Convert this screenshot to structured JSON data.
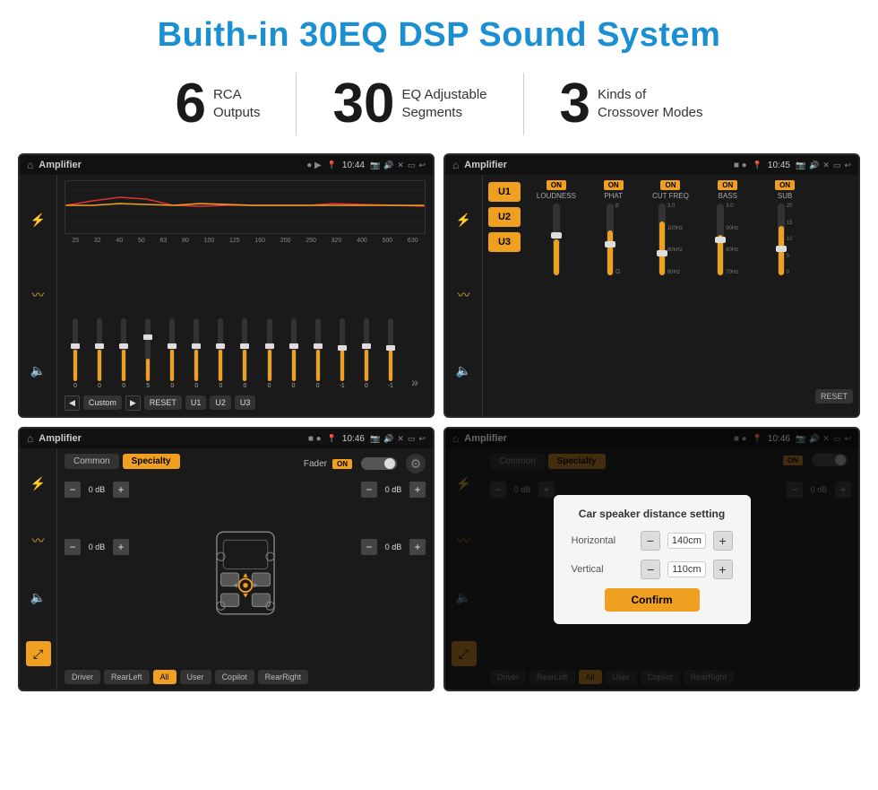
{
  "page": {
    "title": "Buith-in 30EQ DSP Sound System",
    "stats": [
      {
        "number": "6",
        "desc_line1": "RCA",
        "desc_line2": "Outputs"
      },
      {
        "number": "30",
        "desc_line1": "EQ Adjustable",
        "desc_line2": "Segments"
      },
      {
        "number": "3",
        "desc_line1": "Kinds of",
        "desc_line2": "Crossover Modes"
      }
    ]
  },
  "screen1": {
    "title": "Amplifier",
    "time": "10:44",
    "mode": "Custom",
    "freq_labels": [
      "25",
      "32",
      "40",
      "50",
      "63",
      "80",
      "100",
      "125",
      "160",
      "200",
      "250",
      "320",
      "400",
      "500",
      "630"
    ],
    "slider_values": [
      "0",
      "0",
      "0",
      "5",
      "0",
      "0",
      "0",
      "0",
      "0",
      "0",
      "0",
      "-1",
      "0",
      "-1"
    ],
    "buttons": [
      "Custom",
      "RESET",
      "U1",
      "U2",
      "U3"
    ]
  },
  "screen2": {
    "title": "Amplifier",
    "time": "10:45",
    "channels": [
      "LOUDNESS",
      "PHAT",
      "CUT FREQ",
      "BASS",
      "SUB"
    ],
    "u_buttons": [
      "U1",
      "U2",
      "U3"
    ],
    "reset_label": "RESET"
  },
  "screen3": {
    "title": "Amplifier",
    "time": "10:46",
    "tabs": [
      "Common",
      "Specialty"
    ],
    "fader_label": "Fader",
    "fader_on": "ON",
    "db_values": [
      "0 dB",
      "0 dB",
      "0 dB",
      "0 dB"
    ],
    "buttons": [
      "Driver",
      "Copilot",
      "RearLeft",
      "All",
      "User",
      "RearRight"
    ]
  },
  "screen4": {
    "title": "Amplifier",
    "time": "10:46",
    "tabs": [
      "Common",
      "Specialty"
    ],
    "db_values": [
      "0 dB",
      "0 dB"
    ],
    "buttons": [
      "Driver",
      "Copilot",
      "RearLeft",
      "All",
      "User",
      "RearRight"
    ],
    "dialog": {
      "title": "Car speaker distance setting",
      "horizontal_label": "Horizontal",
      "horizontal_value": "140cm",
      "vertical_label": "Vertical",
      "vertical_value": "110cm",
      "confirm_label": "Confirm"
    }
  }
}
